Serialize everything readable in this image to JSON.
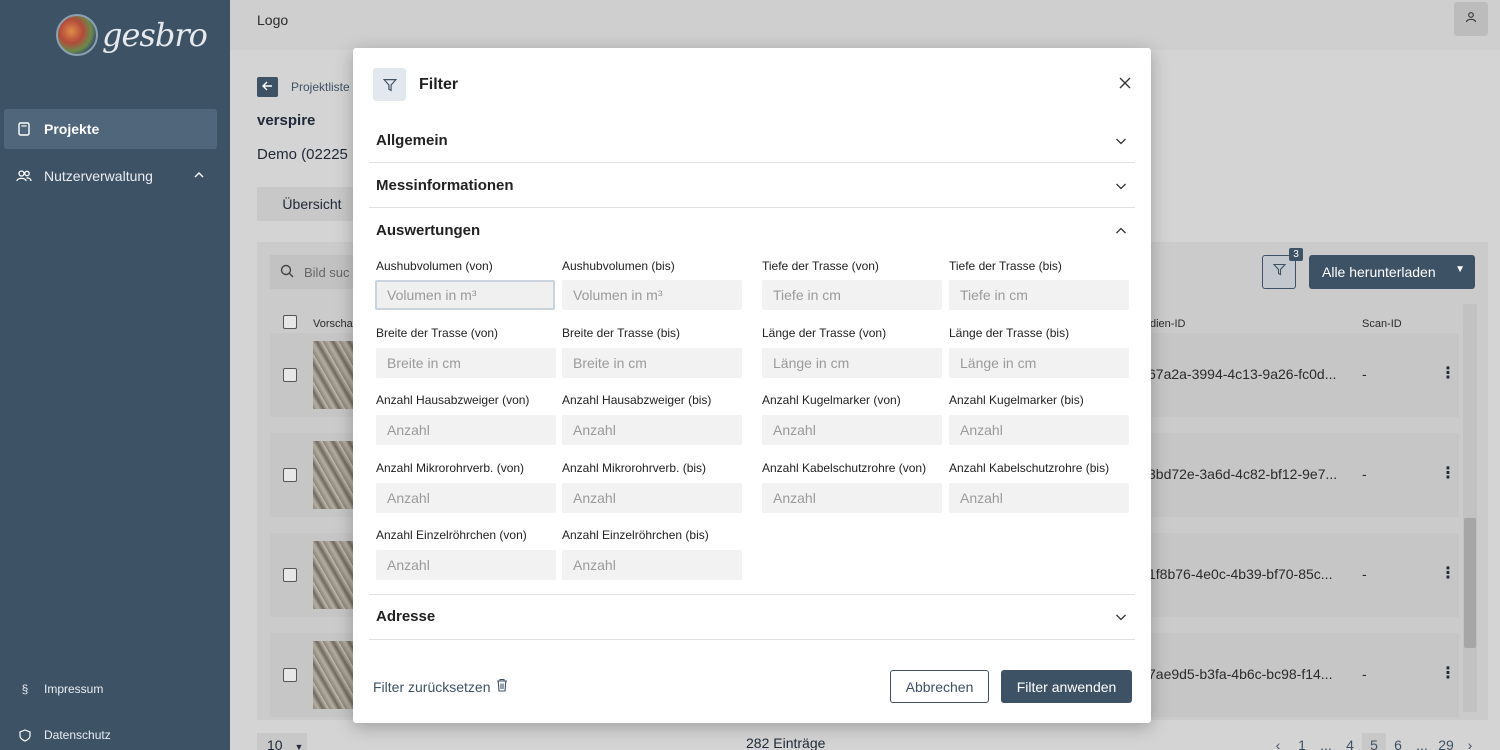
{
  "sidebar": {
    "brand": "gesbro",
    "items": [
      {
        "label": "Projekte",
        "icon": "document-icon",
        "active": true
      },
      {
        "label": "Nutzerverwaltung",
        "icon": "users-icon",
        "active": false
      }
    ],
    "footer": [
      {
        "label": "Impressum",
        "icon": "paragraph-icon"
      },
      {
        "label": "Datenschutz",
        "icon": "shield-icon"
      }
    ]
  },
  "topbar": {
    "title": "Logo"
  },
  "background": {
    "breadcrumb": "Projektliste",
    "project_name": "verspire",
    "project_sub": "Demo (02225",
    "tab_overview": "Übersicht",
    "search_placeholder": "Bild suc",
    "filter_badge": "3",
    "download_label": "Alle herunterladen",
    "columns": {
      "preview": "Vorscha",
      "media_id": "dien-ID",
      "scan_id": "Scan-ID"
    },
    "rows": [
      {
        "id": "67a2a-3994-4c13-9a26-fc0d...",
        "scan": "-"
      },
      {
        "id": "3bd72e-3a6d-4c82-bf12-9e7...",
        "scan": "-"
      },
      {
        "id": "1f8b76-4e0c-4b39-bf70-85c...",
        "scan": "-"
      },
      {
        "id": "7ae9d5-b3fa-4b6c-bc98-f14...",
        "scan": "-"
      }
    ],
    "page_size": "10",
    "entries": "282 Einträge",
    "pager": [
      "‹",
      "1",
      "...",
      "4",
      "5",
      "6",
      "...",
      "29",
      "›"
    ],
    "current_page": "5"
  },
  "modal": {
    "title": "Filter",
    "sections": {
      "general": "Allgemein",
      "measurement": "Messinformationen",
      "evaluations": "Auswertungen",
      "address": "Adresse"
    },
    "fields": [
      {
        "label": "Aushubvolumen (von)",
        "placeholder": "Volumen in m³"
      },
      {
        "label": "Aushubvolumen (bis)",
        "placeholder": "Volumen in m³"
      },
      {
        "label": "Tiefe der Trasse (von)",
        "placeholder": "Tiefe in cm"
      },
      {
        "label": "Tiefe der Trasse (bis)",
        "placeholder": "Tiefe in cm"
      },
      {
        "label": "Breite der Trasse (von)",
        "placeholder": "Breite in cm"
      },
      {
        "label": "Breite der Trasse (bis)",
        "placeholder": "Breite in cm"
      },
      {
        "label": "Länge der Trasse (von)",
        "placeholder": "Länge in cm"
      },
      {
        "label": "Länge der Trasse (bis)",
        "placeholder": "Länge in cm"
      },
      {
        "label": "Anzahl Hausabzweiger (von)",
        "placeholder": "Anzahl"
      },
      {
        "label": "Anzahl Hausabzweiger (bis)",
        "placeholder": "Anzahl"
      },
      {
        "label": "Anzahl Kugelmarker (von)",
        "placeholder": "Anzahl"
      },
      {
        "label": "Anzahl Kugelmarker (bis)",
        "placeholder": "Anzahl"
      },
      {
        "label": "Anzahl Mikrorohrverb. (von)",
        "placeholder": "Anzahl"
      },
      {
        "label": "Anzahl Mikrorohrverb. (bis)",
        "placeholder": "Anzahl"
      },
      {
        "label": "Anzahl Kabelschutzrohre (von)",
        "placeholder": "Anzahl"
      },
      {
        "label": "Anzahl Kabelschutzrohre (bis)",
        "placeholder": "Anzahl"
      },
      {
        "label": "Anzahl Einzelröhrchen (von)",
        "placeholder": "Anzahl"
      },
      {
        "label": "Anzahl Einzelröhrchen (bis)",
        "placeholder": "Anzahl"
      }
    ],
    "reset_label": "Filter zurücksetzen",
    "cancel_label": "Abbrechen",
    "apply_label": "Filter anwenden"
  },
  "colors": {
    "primary": "#3e5266",
    "sidebar": "#3e5266",
    "input_bg": "#f2f2f2"
  }
}
